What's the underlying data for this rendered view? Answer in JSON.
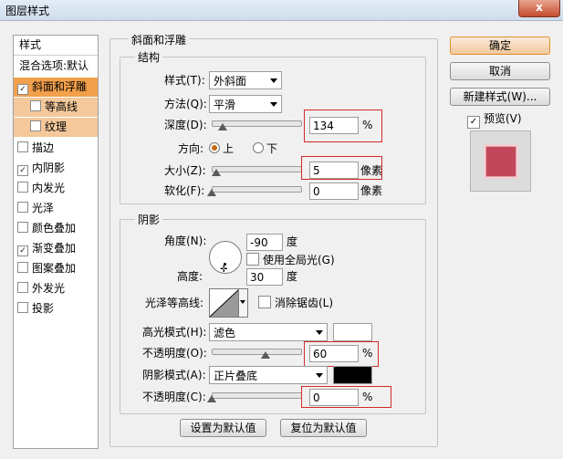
{
  "window": {
    "title": "图层样式",
    "close_label": "x"
  },
  "styles_panel": {
    "header": "样式",
    "blend_options": "混合选项:默认",
    "items": [
      {
        "label": "斜面和浮雕",
        "checked": true,
        "selected": true
      },
      {
        "label": "等高线",
        "checked": false,
        "sub": true
      },
      {
        "label": "纹理",
        "checked": false,
        "sub": true
      },
      {
        "label": "描边",
        "checked": false
      },
      {
        "label": "内阴影",
        "checked": true
      },
      {
        "label": "内发光",
        "checked": false
      },
      {
        "label": "光泽",
        "checked": false
      },
      {
        "label": "颜色叠加",
        "checked": false
      },
      {
        "label": "渐变叠加",
        "checked": true
      },
      {
        "label": "图案叠加",
        "checked": false
      },
      {
        "label": "外发光",
        "checked": false
      },
      {
        "label": "投影",
        "checked": false
      }
    ]
  },
  "bevel": {
    "group_title": "斜面和浮雕",
    "structure": {
      "title": "结构",
      "style_label": "样式(T):",
      "style_value": "外斜面",
      "technique_label": "方法(Q):",
      "technique_value": "平滑",
      "depth_label": "深度(D):",
      "depth_value": "134",
      "depth_unit": "%",
      "direction_label": "方向:",
      "direction_up": "上",
      "direction_down": "下",
      "direction_selected": "上",
      "size_label": "大小(Z):",
      "size_value": "5",
      "size_unit": "像素",
      "soften_label": "软化(F):",
      "soften_value": "0",
      "soften_unit": "像素"
    },
    "shading": {
      "title": "阴影",
      "angle_label": "角度(N):",
      "angle_value": "-90",
      "angle_unit": "度",
      "global_light_label": "使用全局光(G)",
      "global_light_checked": false,
      "altitude_label": "高度:",
      "altitude_value": "30",
      "altitude_unit": "度",
      "gloss_contour_label": "光泽等高线:",
      "anti_aliased_label": "消除锯齿(L)",
      "anti_aliased_checked": false,
      "highlight_mode_label": "高光模式(H):",
      "highlight_mode_value": "滤色",
      "highlight_color": "#ffffff",
      "highlight_opacity_label": "不透明度(O):",
      "highlight_opacity_value": "60",
      "highlight_opacity_unit": "%",
      "shadow_mode_label": "阴影模式(A):",
      "shadow_mode_value": "正片叠底",
      "shadow_color": "#000000",
      "shadow_opacity_label": "不透明度(C):",
      "shadow_opacity_value": "0",
      "shadow_opacity_unit": "%"
    },
    "make_default": "设置为默认值",
    "reset_default": "复位为默认值"
  },
  "right": {
    "ok": "确定",
    "cancel": "取消",
    "new_style": "新建样式(W)...",
    "preview_label": "预览(V)",
    "preview_checked": true,
    "preview_color": "#c0485a"
  },
  "colors": {
    "highlight_box": "#d42a2a",
    "selected_item": "#f2a04b"
  }
}
